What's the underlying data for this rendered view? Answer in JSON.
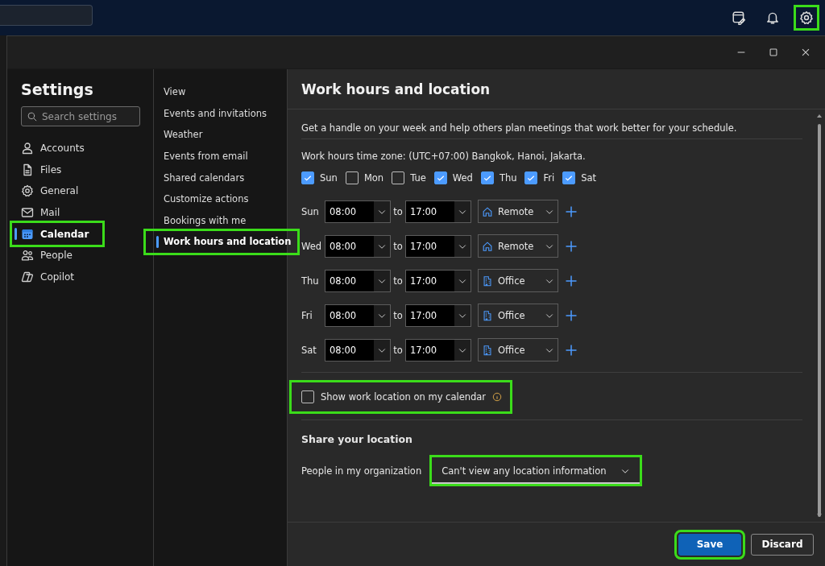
{
  "top_bar": {
    "settings_highlighted": true
  },
  "settings": {
    "title": "Settings",
    "search": {
      "placeholder": "Search settings"
    },
    "items": [
      {
        "label": "Accounts",
        "selected": false,
        "highlighted": false
      },
      {
        "label": "Files",
        "selected": false,
        "highlighted": false
      },
      {
        "label": "General",
        "selected": false,
        "highlighted": false
      },
      {
        "label": "Mail",
        "selected": false,
        "highlighted": false
      },
      {
        "label": "Calendar",
        "selected": true,
        "highlighted": true
      },
      {
        "label": "People",
        "selected": false,
        "highlighted": false
      },
      {
        "label": "Copilot",
        "selected": false,
        "highlighted": false
      }
    ]
  },
  "subnav": {
    "items": [
      {
        "label": "View",
        "selected": false,
        "highlighted": false
      },
      {
        "label": "Events and invitations",
        "selected": false,
        "highlighted": false
      },
      {
        "label": "Weather",
        "selected": false,
        "highlighted": false
      },
      {
        "label": "Events from email",
        "selected": false,
        "highlighted": false
      },
      {
        "label": "Shared calendars",
        "selected": false,
        "highlighted": false
      },
      {
        "label": "Customize actions",
        "selected": false,
        "highlighted": false
      },
      {
        "label": "Bookings with me",
        "selected": false,
        "highlighted": false
      },
      {
        "label": "Work hours and location",
        "selected": true,
        "highlighted": true
      }
    ]
  },
  "panel": {
    "title": "Work hours and location",
    "intro": "Get a handle on your week and help others plan meetings that work better for your schedule.",
    "timezone": "Work hours time zone: (UTC+07:00) Bangkok, Hanoi, Jakarta.",
    "days": [
      {
        "label": "Sun",
        "checked": true
      },
      {
        "label": "Mon",
        "checked": false
      },
      {
        "label": "Tue",
        "checked": false
      },
      {
        "label": "Wed",
        "checked": true
      },
      {
        "label": "Thu",
        "checked": true
      },
      {
        "label": "Fri",
        "checked": true
      },
      {
        "label": "Sat",
        "checked": true
      }
    ],
    "schedule": [
      {
        "day": "Sun",
        "start": "08:00",
        "to": "to",
        "end": "17:00",
        "location": "Remote",
        "kind": "remote"
      },
      {
        "day": "Wed",
        "start": "08:00",
        "to": "to",
        "end": "17:00",
        "location": "Remote",
        "kind": "remote"
      },
      {
        "day": "Thu",
        "start": "08:00",
        "to": "to",
        "end": "17:00",
        "location": "Office",
        "kind": "office"
      },
      {
        "day": "Fri",
        "start": "08:00",
        "to": "to",
        "end": "17:00",
        "location": "Office",
        "kind": "office"
      },
      {
        "day": "Sat",
        "start": "08:00",
        "to": "to",
        "end": "17:00",
        "location": "Office",
        "kind": "office"
      }
    ],
    "show_location": {
      "label": "Show work location on my calendar",
      "checked": false,
      "highlighted": true
    },
    "share": {
      "title": "Share your location",
      "label": "People in my organization",
      "value": "Can't view any location information",
      "highlighted": true
    }
  },
  "buttons": [
    {
      "label": "Save",
      "kind": "primary",
      "highlighted": true
    },
    {
      "label": "Discard",
      "kind": "secondary",
      "highlighted": false
    }
  ]
}
